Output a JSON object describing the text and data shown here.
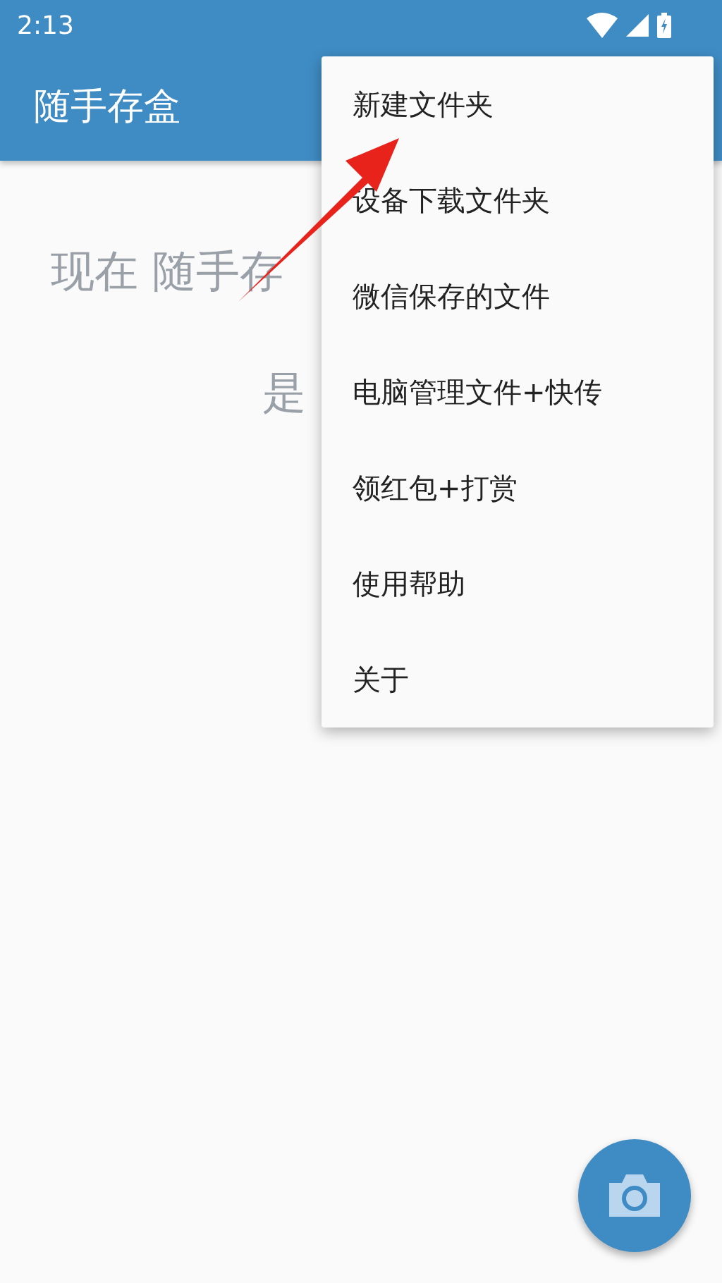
{
  "status_bar": {
    "time": "2:13"
  },
  "app_bar": {
    "title": "随手存盒"
  },
  "empty_message": {
    "lines": [
      "现在 随手存",
      "是"
    ]
  },
  "menu": {
    "items": [
      "新建文件夹",
      "设备下载文件夹",
      "微信保存的文件",
      "电脑管理文件+快传",
      "领红包+打赏",
      "使用帮助",
      "关于"
    ]
  }
}
